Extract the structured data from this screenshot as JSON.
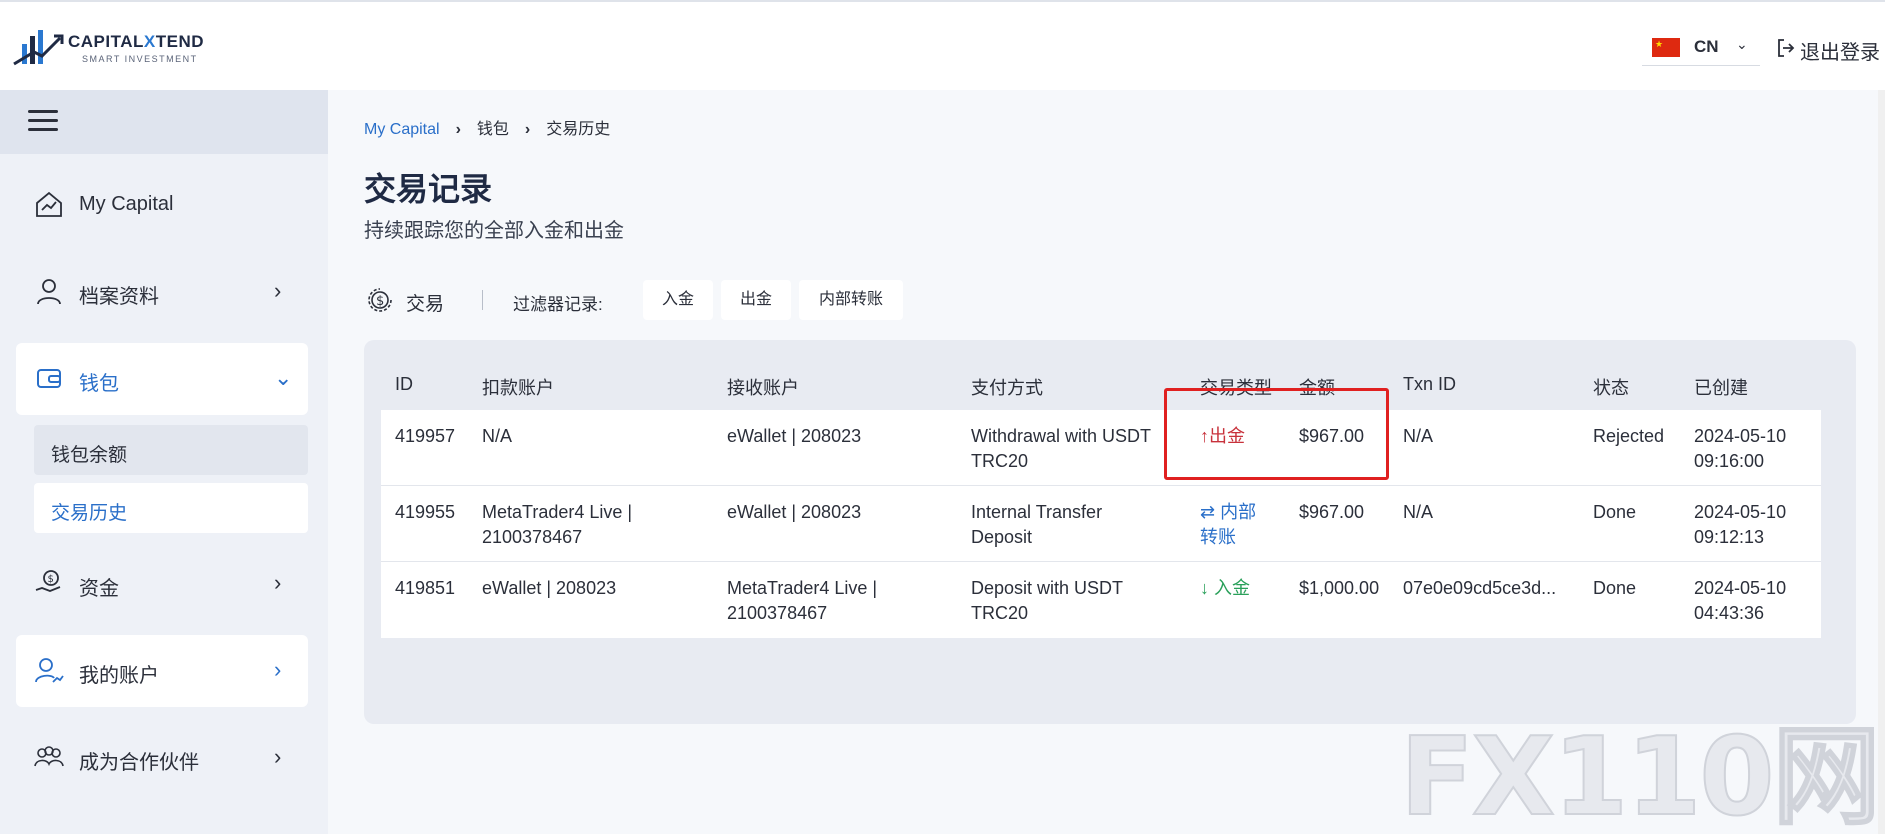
{
  "header": {
    "logo_main_a": "CAPITAL",
    "logo_main_x": "X",
    "logo_main_b": "TEND",
    "logo_sub": "SMART INVESTMENT",
    "language": "CN",
    "logout": "退出登录"
  },
  "sidebar": {
    "items": [
      {
        "label": "My Capital",
        "icon": "home-chart-icon"
      },
      {
        "label": "档案资料",
        "icon": "user-icon"
      },
      {
        "label": "钱包",
        "icon": "wallet-icon"
      },
      {
        "label": "资金",
        "icon": "money-hand-icon"
      },
      {
        "label": "我的账户",
        "icon": "user-chart-icon"
      },
      {
        "label": "成为合作伙伴",
        "icon": "group-icon"
      }
    ],
    "wallet_sub": [
      "钱包余额",
      "交易历史"
    ]
  },
  "breadcrumb": [
    "My Capital",
    "钱包",
    "交易历史"
  ],
  "page": {
    "title": "交易记录",
    "subtitle": "持续跟踪您的全部入金和出金"
  },
  "filters": {
    "tx_label": "交易",
    "filter_label": "过滤器记录:",
    "buttons": [
      "入金",
      "出金",
      "内部转账"
    ]
  },
  "table": {
    "headers": [
      "ID",
      "扣款账户",
      "接收账户",
      "支付方式",
      "交易类型",
      "金额",
      "Txn ID",
      "状态",
      "已创建"
    ],
    "rows": [
      {
        "id": "419957",
        "from": "N/A",
        "to": "eWallet | 208023",
        "method_1": "Withdrawal with USDT",
        "method_2": "TRC20",
        "type_icon": "↑",
        "type_1": "出金",
        "type_2": "",
        "amount": "$967.00",
        "txn": "N/A",
        "status": "Rejected",
        "date": "2024-05-10",
        "time": "09:16:00"
      },
      {
        "id": "419955",
        "from_1": "MetaTrader4 Live |",
        "from_2": "2100378467",
        "to": "eWallet | 208023",
        "method_1": "Internal Transfer",
        "method_2": "Deposit",
        "type_icon": "⇄",
        "type_1": "内部",
        "type_2": "转账",
        "amount": "$967.00",
        "txn": "N/A",
        "status": "Done",
        "date": "2024-05-10",
        "time": "09:12:13"
      },
      {
        "id": "419851",
        "from": "eWallet | 208023",
        "to_1": "MetaTrader4 Live |",
        "to_2": "2100378467",
        "method_1": "Deposit with USDT",
        "method_2": "TRC20",
        "type_icon": "↓",
        "type_1": "入金",
        "amount": "$1,000.00",
        "txn": "07e0e09cd5ce3d...",
        "status": "Done",
        "date": "2024-05-10",
        "time": "04:43:36"
      }
    ]
  },
  "colors": {
    "accent": "#2a6fc9",
    "withdraw": "#c8323c",
    "deposit": "#2aa05a",
    "highlight": "#e02020"
  },
  "watermark": "FX110网"
}
